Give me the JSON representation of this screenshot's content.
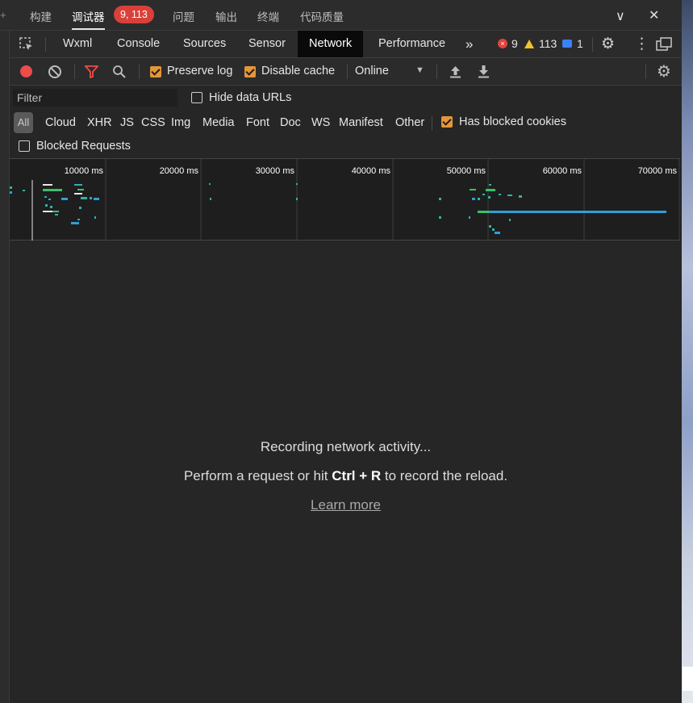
{
  "ide_tabs": {
    "edge_glyph": "+",
    "items": [
      {
        "label": "构建"
      },
      {
        "label": "调试器"
      },
      {
        "label": "问题"
      },
      {
        "label": "输出"
      },
      {
        "label": "终端"
      },
      {
        "label": "代码质量"
      }
    ],
    "debugger_badge": "9, 113",
    "chevron_glyph": "∨",
    "close_glyph": "✕"
  },
  "panel_tabs": {
    "items": [
      "Wxml",
      "Console",
      "Sources",
      "Sensor",
      "Network",
      "Performance"
    ],
    "more_glyph": "»",
    "error_count": "9",
    "warning_count": "113",
    "message_count": "1",
    "gear_glyph": "⚙",
    "kebab_glyph": "⋮"
  },
  "network_toolbar": {
    "preserve_log": {
      "label": "Preserve log",
      "checked": true
    },
    "disable_cache": {
      "label": "Disable cache",
      "checked": true
    },
    "throttling": "Online",
    "dropdown_glyph": "▼"
  },
  "filter": {
    "placeholder": "Filter",
    "hide_data_urls": {
      "label": "Hide data URLs",
      "checked": false
    },
    "types": [
      "All",
      "Cloud",
      "XHR",
      "JS",
      "CSS",
      "Img",
      "Media",
      "Font",
      "Doc",
      "WS",
      "Manifest",
      "Other"
    ],
    "has_blocked_cookies": {
      "label": "Has blocked cookies",
      "checked": true
    },
    "blocked_requests": {
      "label": "Blocked Requests",
      "checked": false
    }
  },
  "overview": {
    "tick_labels": [
      "10000 ms",
      "20000 ms",
      "30000 ms",
      "40000 ms",
      "50000 ms",
      "60000 ms",
      "70000 ms"
    ]
  },
  "empty_state": {
    "title": "Recording network activity...",
    "hint_prefix": "Perform a request or hit ",
    "hint_keys": "Ctrl + R",
    "hint_suffix": " to record the reload.",
    "learn_more": "Learn more"
  },
  "colors": {
    "record_red": "#ee4b4b",
    "badge_red": "#d9403a",
    "checkbox_orange": "#e4963a",
    "bar_green": "#3bbf6a",
    "bar_blue": "#2f9fd8",
    "bar_teal": "#2bb3a8"
  }
}
